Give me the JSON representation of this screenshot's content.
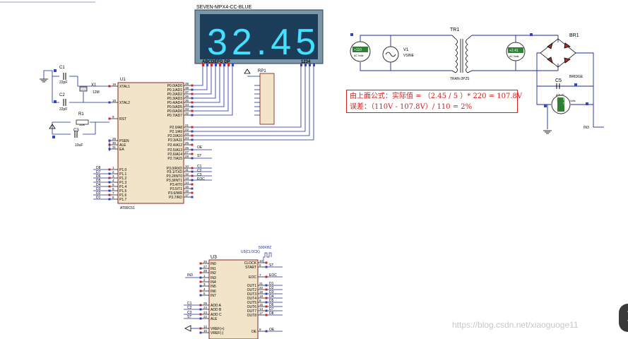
{
  "display": {
    "title": "SEVEN-MPX4-CC-BLUE",
    "digits": "32.45",
    "segment_labels": "ABCDEFG  DP",
    "digit_labels": "1234"
  },
  "parts": {
    "u1": "U1",
    "u1_type": "AT89C51",
    "u3": "U3",
    "u3_clock": "U3(CLOCK)",
    "clock_freq": "500KHZ",
    "rp1": "RP1",
    "c1": "C1",
    "c1_val": "22pF",
    "c2": "C2",
    "c2_val": "22pF",
    "c3": "C3",
    "c3_val": "10uF",
    "x1": "X1",
    "x1_val": "12M",
    "r1": "R1",
    "r1_val": "10k",
    "v1": "V1",
    "v1_type": "VSINE",
    "tr1": "TR1",
    "tr1_type": "TRAN-2P2S",
    "br1": "BR1",
    "br1_type": "BRIDGE",
    "c5": "C5",
    "c5_val": "47uF",
    "in3_label": "IN3"
  },
  "u1_left_pins": [
    {
      "num": "19",
      "name": "XTAL1"
    },
    {
      "num": "18",
      "name": "XTAL2"
    },
    {
      "num": "9",
      "name": "RST"
    },
    {
      "num": "29",
      "name": "PSEN"
    },
    {
      "num": "30",
      "name": "ALE"
    },
    {
      "num": "31",
      "name": "EA"
    },
    {
      "num": "1",
      "name": "P1.0"
    },
    {
      "num": "2",
      "name": "P1.1"
    },
    {
      "num": "3",
      "name": "P1.2"
    },
    {
      "num": "4",
      "name": "P1.3"
    },
    {
      "num": "5",
      "name": "P1.4"
    },
    {
      "num": "6",
      "name": "P1.5"
    },
    {
      "num": "7",
      "name": "P1.6"
    },
    {
      "num": "8",
      "name": "P1.7"
    }
  ],
  "u1_right_pins": [
    {
      "num": "39",
      "name": "P0.0/AD0"
    },
    {
      "num": "38",
      "name": "P0.1/AD1"
    },
    {
      "num": "37",
      "name": "P0.2/AD2"
    },
    {
      "num": "36",
      "name": "P0.3/AD3"
    },
    {
      "num": "35",
      "name": "P0.4/AD4"
    },
    {
      "num": "34",
      "name": "P0.5/AD5"
    },
    {
      "num": "33",
      "name": "P0.6/AD6"
    },
    {
      "num": "32",
      "name": "P0.7/AD7"
    },
    {
      "num": "21",
      "name": "P2.0/A8"
    },
    {
      "num": "22",
      "name": "P2.1/A9"
    },
    {
      "num": "23",
      "name": "P2.2/A10"
    },
    {
      "num": "24",
      "name": "P2.3/A11"
    },
    {
      "num": "25",
      "name": "P2.4/A12"
    },
    {
      "num": "26",
      "name": "P2.5/A13"
    },
    {
      "num": "27",
      "name": "P2.6/A14"
    },
    {
      "num": "28",
      "name": "P2.7/A15"
    },
    {
      "num": "10",
      "name": "P3.0/RXD"
    },
    {
      "num": "11",
      "name": "P3.1/TXD"
    },
    {
      "num": "12",
      "name": "P3.2/INT0"
    },
    {
      "num": "13",
      "name": "P3.3/INT1"
    },
    {
      "num": "14",
      "name": "P3.4/T0"
    },
    {
      "num": "15",
      "name": "P3.5/T1"
    },
    {
      "num": "16",
      "name": "P3.6/WR"
    },
    {
      "num": "17",
      "name": "P3.7/RD"
    }
  ],
  "u1_p1_nets": [
    "D8",
    "D7",
    "D6",
    "D5",
    "D4",
    "D3",
    "D2",
    "D1"
  ],
  "u1_p2_nets": [
    "OE",
    "ST"
  ],
  "u1_p3_nets": [
    "C1",
    "C2",
    "C3",
    "EOC"
  ],
  "u3_left_pins": [
    {
      "num": "26",
      "name": "IN0"
    },
    {
      "num": "27",
      "name": "IN1"
    },
    {
      "num": "28",
      "name": "IN2"
    },
    {
      "num": "1",
      "name": "IN3"
    },
    {
      "num": "2",
      "name": "IN4"
    },
    {
      "num": "3",
      "name": "IN5"
    },
    {
      "num": "4",
      "name": "IN6"
    },
    {
      "num": "5",
      "name": "IN7"
    },
    {
      "num": "25",
      "name": "ADD A"
    },
    {
      "num": "24",
      "name": "ADD B"
    },
    {
      "num": "23",
      "name": "ADD C"
    },
    {
      "num": "22",
      "name": "ALE"
    },
    {
      "num": "12",
      "name": "VREF(+)"
    },
    {
      "num": "16",
      "name": "VREF(-)"
    }
  ],
  "u3_left_nets": [
    "C1",
    "C2",
    "C3",
    "ST"
  ],
  "u3_right_pins": [
    {
      "num": "10",
      "name": "CLOCK"
    },
    {
      "num": "6",
      "name": "START"
    },
    {
      "num": "7",
      "name": "EOC"
    },
    {
      "num": "21",
      "name": "OUT1"
    },
    {
      "num": "20",
      "name": "OUT2"
    },
    {
      "num": "19",
      "name": "OUT3"
    },
    {
      "num": "18",
      "name": "OUT4"
    },
    {
      "num": "8",
      "name": "OUT5"
    },
    {
      "num": "15",
      "name": "OUT6"
    },
    {
      "num": "14",
      "name": "OUT7"
    },
    {
      "num": "17",
      "name": "OUT8"
    },
    {
      "num": "9",
      "name": "OE"
    }
  ],
  "u3_right_nets": [
    "ST",
    "EOC",
    "D1",
    "D2",
    "D3",
    "D4",
    "D5",
    "D6",
    "D7",
    "D8",
    "OE"
  ],
  "meters": {
    "left": {
      "value": "+110",
      "unit": "AC Volts"
    },
    "right": {
      "value": "+2.41",
      "unit": "AC Volts"
    },
    "dc": {
      "value": "+2.45",
      "unit": "Volts"
    }
  },
  "note": {
    "line1": "由上面公式：实际值 = （2.45 / 5 ）* 220 = 107.8V",
    "line2": "误差：（110V - 107.8V）/ 110 = 2%"
  },
  "watermark": "https://blog.csdn.net/xiaoguoge11",
  "colors": {
    "wire": "#1a2a9a",
    "chip_fill": "#f2e4c8",
    "chip_stroke": "#7a1010",
    "display_bg": "#1c3d5a",
    "segment_on": "#44e0ff",
    "meter_green": "#2f7f35",
    "note_red": "#d02020"
  }
}
